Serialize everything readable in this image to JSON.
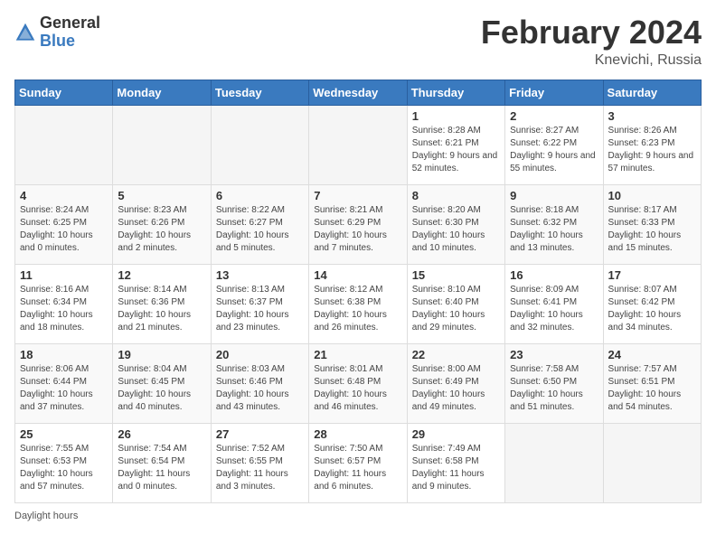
{
  "logo": {
    "text_general": "General",
    "text_blue": "Blue",
    "tagline": "GeneralBlue"
  },
  "calendar": {
    "title": "February 2024",
    "subtitle": "Knevichi, Russia"
  },
  "days_of_week": [
    "Sunday",
    "Monday",
    "Tuesday",
    "Wednesday",
    "Thursday",
    "Friday",
    "Saturday"
  ],
  "weeks": [
    [
      {
        "day": "",
        "sunrise": "",
        "sunset": "",
        "daylight": "",
        "empty": true
      },
      {
        "day": "",
        "sunrise": "",
        "sunset": "",
        "daylight": "",
        "empty": true
      },
      {
        "day": "",
        "sunrise": "",
        "sunset": "",
        "daylight": "",
        "empty": true
      },
      {
        "day": "",
        "sunrise": "",
        "sunset": "",
        "daylight": "",
        "empty": true
      },
      {
        "day": "1",
        "sunrise": "Sunrise: 8:28 AM",
        "sunset": "Sunset: 6:21 PM",
        "daylight": "Daylight: 9 hours and 52 minutes.",
        "empty": false
      },
      {
        "day": "2",
        "sunrise": "Sunrise: 8:27 AM",
        "sunset": "Sunset: 6:22 PM",
        "daylight": "Daylight: 9 hours and 55 minutes.",
        "empty": false
      },
      {
        "day": "3",
        "sunrise": "Sunrise: 8:26 AM",
        "sunset": "Sunset: 6:23 PM",
        "daylight": "Daylight: 9 hours and 57 minutes.",
        "empty": false
      }
    ],
    [
      {
        "day": "4",
        "sunrise": "Sunrise: 8:24 AM",
        "sunset": "Sunset: 6:25 PM",
        "daylight": "Daylight: 10 hours and 0 minutes.",
        "empty": false
      },
      {
        "day": "5",
        "sunrise": "Sunrise: 8:23 AM",
        "sunset": "Sunset: 6:26 PM",
        "daylight": "Daylight: 10 hours and 2 minutes.",
        "empty": false
      },
      {
        "day": "6",
        "sunrise": "Sunrise: 8:22 AM",
        "sunset": "Sunset: 6:27 PM",
        "daylight": "Daylight: 10 hours and 5 minutes.",
        "empty": false
      },
      {
        "day": "7",
        "sunrise": "Sunrise: 8:21 AM",
        "sunset": "Sunset: 6:29 PM",
        "daylight": "Daylight: 10 hours and 7 minutes.",
        "empty": false
      },
      {
        "day": "8",
        "sunrise": "Sunrise: 8:20 AM",
        "sunset": "Sunset: 6:30 PM",
        "daylight": "Daylight: 10 hours and 10 minutes.",
        "empty": false
      },
      {
        "day": "9",
        "sunrise": "Sunrise: 8:18 AM",
        "sunset": "Sunset: 6:32 PM",
        "daylight": "Daylight: 10 hours and 13 minutes.",
        "empty": false
      },
      {
        "day": "10",
        "sunrise": "Sunrise: 8:17 AM",
        "sunset": "Sunset: 6:33 PM",
        "daylight": "Daylight: 10 hours and 15 minutes.",
        "empty": false
      }
    ],
    [
      {
        "day": "11",
        "sunrise": "Sunrise: 8:16 AM",
        "sunset": "Sunset: 6:34 PM",
        "daylight": "Daylight: 10 hours and 18 minutes.",
        "empty": false
      },
      {
        "day": "12",
        "sunrise": "Sunrise: 8:14 AM",
        "sunset": "Sunset: 6:36 PM",
        "daylight": "Daylight: 10 hours and 21 minutes.",
        "empty": false
      },
      {
        "day": "13",
        "sunrise": "Sunrise: 8:13 AM",
        "sunset": "Sunset: 6:37 PM",
        "daylight": "Daylight: 10 hours and 23 minutes.",
        "empty": false
      },
      {
        "day": "14",
        "sunrise": "Sunrise: 8:12 AM",
        "sunset": "Sunset: 6:38 PM",
        "daylight": "Daylight: 10 hours and 26 minutes.",
        "empty": false
      },
      {
        "day": "15",
        "sunrise": "Sunrise: 8:10 AM",
        "sunset": "Sunset: 6:40 PM",
        "daylight": "Daylight: 10 hours and 29 minutes.",
        "empty": false
      },
      {
        "day": "16",
        "sunrise": "Sunrise: 8:09 AM",
        "sunset": "Sunset: 6:41 PM",
        "daylight": "Daylight: 10 hours and 32 minutes.",
        "empty": false
      },
      {
        "day": "17",
        "sunrise": "Sunrise: 8:07 AM",
        "sunset": "Sunset: 6:42 PM",
        "daylight": "Daylight: 10 hours and 34 minutes.",
        "empty": false
      }
    ],
    [
      {
        "day": "18",
        "sunrise": "Sunrise: 8:06 AM",
        "sunset": "Sunset: 6:44 PM",
        "daylight": "Daylight: 10 hours and 37 minutes.",
        "empty": false
      },
      {
        "day": "19",
        "sunrise": "Sunrise: 8:04 AM",
        "sunset": "Sunset: 6:45 PM",
        "daylight": "Daylight: 10 hours and 40 minutes.",
        "empty": false
      },
      {
        "day": "20",
        "sunrise": "Sunrise: 8:03 AM",
        "sunset": "Sunset: 6:46 PM",
        "daylight": "Daylight: 10 hours and 43 minutes.",
        "empty": false
      },
      {
        "day": "21",
        "sunrise": "Sunrise: 8:01 AM",
        "sunset": "Sunset: 6:48 PM",
        "daylight": "Daylight: 10 hours and 46 minutes.",
        "empty": false
      },
      {
        "day": "22",
        "sunrise": "Sunrise: 8:00 AM",
        "sunset": "Sunset: 6:49 PM",
        "daylight": "Daylight: 10 hours and 49 minutes.",
        "empty": false
      },
      {
        "day": "23",
        "sunrise": "Sunrise: 7:58 AM",
        "sunset": "Sunset: 6:50 PM",
        "daylight": "Daylight: 10 hours and 51 minutes.",
        "empty": false
      },
      {
        "day": "24",
        "sunrise": "Sunrise: 7:57 AM",
        "sunset": "Sunset: 6:51 PM",
        "daylight": "Daylight: 10 hours and 54 minutes.",
        "empty": false
      }
    ],
    [
      {
        "day": "25",
        "sunrise": "Sunrise: 7:55 AM",
        "sunset": "Sunset: 6:53 PM",
        "daylight": "Daylight: 10 hours and 57 minutes.",
        "empty": false
      },
      {
        "day": "26",
        "sunrise": "Sunrise: 7:54 AM",
        "sunset": "Sunset: 6:54 PM",
        "daylight": "Daylight: 11 hours and 0 minutes.",
        "empty": false
      },
      {
        "day": "27",
        "sunrise": "Sunrise: 7:52 AM",
        "sunset": "Sunset: 6:55 PM",
        "daylight": "Daylight: 11 hours and 3 minutes.",
        "empty": false
      },
      {
        "day": "28",
        "sunrise": "Sunrise: 7:50 AM",
        "sunset": "Sunset: 6:57 PM",
        "daylight": "Daylight: 11 hours and 6 minutes.",
        "empty": false
      },
      {
        "day": "29",
        "sunrise": "Sunrise: 7:49 AM",
        "sunset": "Sunset: 6:58 PM",
        "daylight": "Daylight: 11 hours and 9 minutes.",
        "empty": false
      },
      {
        "day": "",
        "sunrise": "",
        "sunset": "",
        "daylight": "",
        "empty": true
      },
      {
        "day": "",
        "sunrise": "",
        "sunset": "",
        "daylight": "",
        "empty": true
      }
    ]
  ],
  "footer": {
    "daylight_label": "Daylight hours"
  }
}
